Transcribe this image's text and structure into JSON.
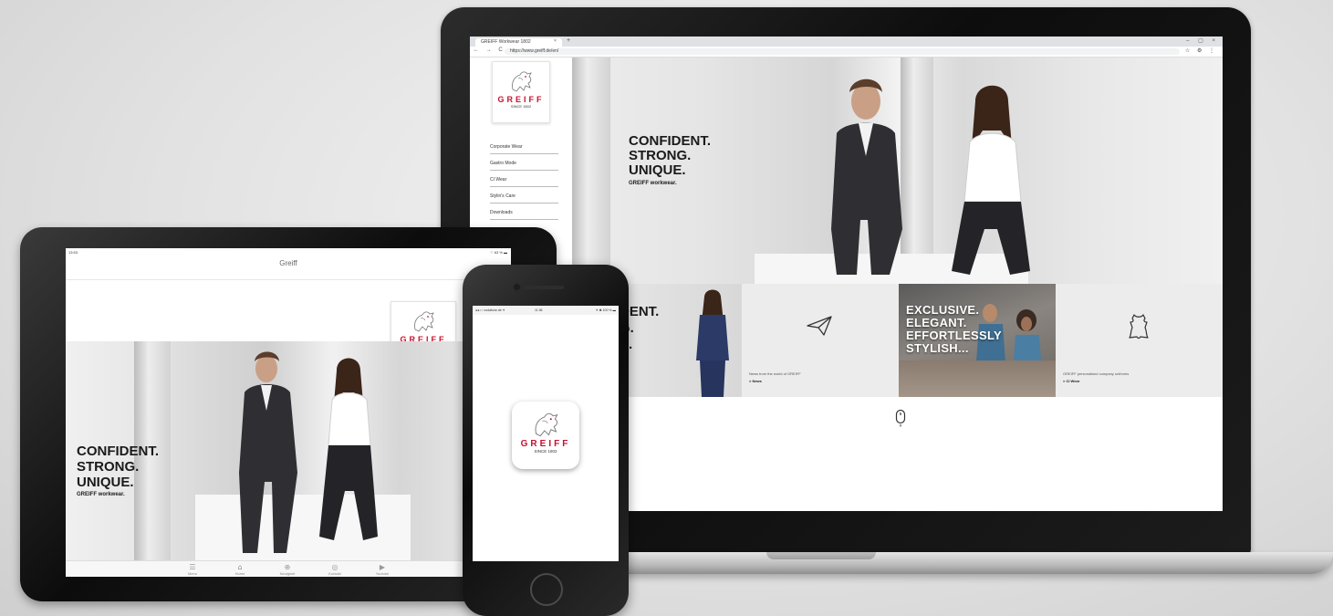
{
  "laptop": {
    "browser": {
      "tab_title": "GREIFF Workwear 1802",
      "tab_close": "×",
      "new_tab": "+",
      "window_controls": "– ▢ ×",
      "nav_buttons": "← → C",
      "url": "https://www.greiff.de/en/",
      "url_icons": "☆ ⚙ ⋮"
    },
    "logo": {
      "word": "GREIFF",
      "since": "SINCE 1802"
    },
    "menu": [
      "Corporate Wear",
      "Gastro Mode",
      "CI Wear",
      "Stylin's Care",
      "Downloads"
    ],
    "hero": {
      "tagline_lines": [
        "CONFIDENT.",
        "STRONG.",
        "UNIQUE."
      ],
      "sub": "GREIFF workwear."
    },
    "tiles": {
      "partial_lines": [
        "DENT.",
        "G.",
        "E."
      ],
      "news_caption": "News from the world of GREIFF",
      "news_link": "> News",
      "exclusive_lines": [
        "EXCLUSIVE.",
        "ELEGANT.",
        "EFFORTLESSLY",
        "STYLISH..."
      ],
      "ci_caption": "GREIFF personalised company uniforms",
      "ci_link": "> CI Wear"
    }
  },
  "tablet": {
    "status_time": "13:53",
    "status_battery": "⌔ 63 % ▬",
    "title": "Greiff",
    "logo": {
      "word": "GREIFF",
      "since": "SINCE 1802"
    },
    "hero": {
      "tagline_lines": [
        "CONFIDENT.",
        "STRONG.",
        "UNIQUE."
      ],
      "sub": "GREIFF workwear."
    },
    "tabs": [
      {
        "icon": "☰",
        "label": "Menu"
      },
      {
        "icon": "⌂",
        "label": "Home"
      },
      {
        "icon": "⊕",
        "label": "Neuigkeit"
      },
      {
        "icon": "◎",
        "label": "Kontakt"
      },
      {
        "icon": "▶",
        "label": "Youtube"
      }
    ]
  },
  "phone": {
    "status_carrier": "●●○○ vodafone.de ✦",
    "status_time": "11:36",
    "status_battery": "✈ ✱ 100 % ▬",
    "icon_word": "GREIFF",
    "icon_since": "SINCE 1802"
  },
  "colors": {
    "brand_red": "#c8102e",
    "text_dark": "#1a1a1a"
  }
}
